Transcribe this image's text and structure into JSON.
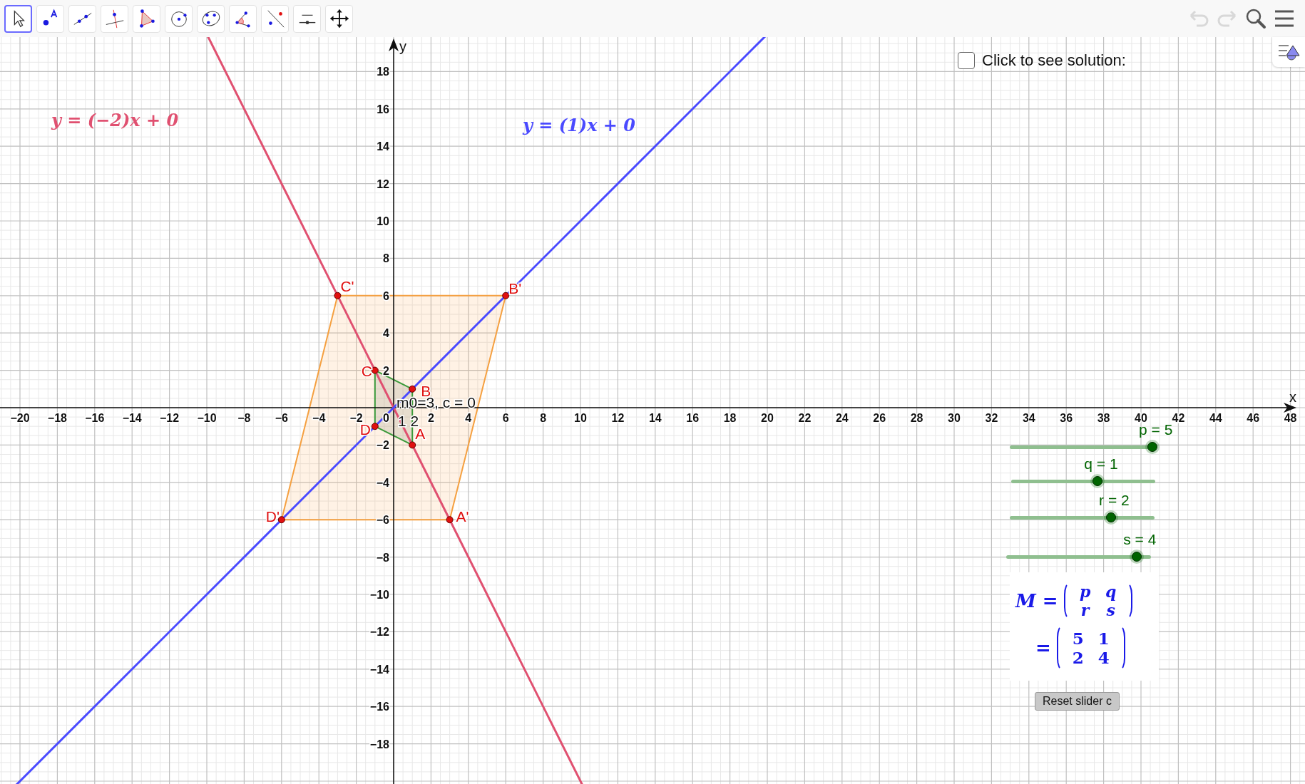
{
  "toolbar": {
    "tools": [
      {
        "kind": "move",
        "selected": true
      },
      {
        "kind": "point",
        "selected": false
      },
      {
        "kind": "line",
        "selected": false
      },
      {
        "kind": "perpendicular",
        "selected": false
      },
      {
        "kind": "polygon",
        "selected": false
      },
      {
        "kind": "circle",
        "selected": false
      },
      {
        "kind": "conic",
        "selected": false
      },
      {
        "kind": "angle",
        "selected": false
      },
      {
        "kind": "reflect",
        "selected": false
      },
      {
        "kind": "slider",
        "selected": false
      },
      {
        "kind": "pan",
        "selected": false
      }
    ],
    "undo": {
      "disabled": true
    },
    "redo": {
      "disabled": true
    }
  },
  "graphics": {
    "x_axis_label": "x",
    "y_axis_label": "y",
    "origin_label": "0",
    "x_tick_labels": [
      "−20",
      "−18",
      "−16",
      "−14",
      "−12",
      "−10",
      "−8",
      "−6",
      "−4",
      "−2",
      "2",
      "4",
      "6",
      "8",
      "10",
      "12",
      "14",
      "16",
      "18",
      "20",
      "22",
      "24",
      "26",
      "28",
      "30",
      "32",
      "34",
      "36",
      "38",
      "40",
      "42",
      "44",
      "46",
      "48"
    ],
    "y_tick_labels": [
      "18",
      "16",
      "14",
      "12",
      "10",
      "8",
      "6",
      "4",
      "2",
      "−2",
      "−4",
      "−6",
      "−8",
      "−10",
      "−12",
      "−14",
      "−16",
      "−18"
    ],
    "lines": [
      {
        "equation": "y = (−2)x + 0",
        "color": "#e05070"
      },
      {
        "equation": "y = (1)x + 0",
        "color": "#4a4aff"
      }
    ],
    "points": [
      {
        "label": "A"
      },
      {
        "label": "B"
      },
      {
        "label": "C"
      },
      {
        "label": "D"
      },
      {
        "label": "A'"
      },
      {
        "label": "B'"
      },
      {
        "label": "C'"
      },
      {
        "label": "D'"
      }
    ],
    "texts": [
      "m0=3, c = 0",
      "1 2"
    ]
  },
  "checkbox": {
    "label": "Click to see solution:",
    "checked": false
  },
  "sliders": [
    {
      "label": "p = 5",
      "level": 1
    },
    {
      "label": "q = 1",
      "level": 0.6
    },
    {
      "label": "r = 2",
      "level": 0.7
    },
    {
      "label": "s = 4",
      "level": 0.9
    }
  ],
  "matrix": {
    "symbolic_lhs": "M =",
    "symbolic": [
      [
        "p",
        "q"
      ],
      [
        "r",
        "s"
      ]
    ],
    "numeric_lhs": "=",
    "numeric": [
      [
        "5",
        "1"
      ],
      [
        "2",
        "4"
      ]
    ]
  },
  "reset_button": "Reset slider c"
}
